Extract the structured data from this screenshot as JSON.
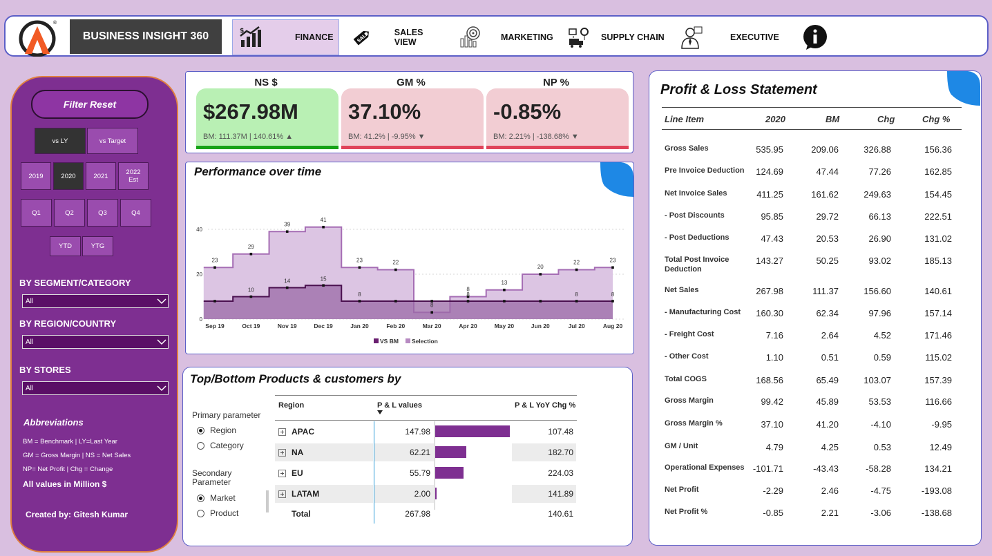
{
  "nav": {
    "brand": "BUSINESS INSIGHT 360",
    "items": [
      {
        "label": "FINANCE",
        "icon": "finance-chart-icon"
      },
      {
        "label": "SALES VIEW",
        "icon": "sale-tag-icon"
      },
      {
        "label": "MARKETING",
        "icon": "target-chart-icon"
      },
      {
        "label": "SUPPLY CHAIN",
        "icon": "supply-chain-icon"
      },
      {
        "label": "EXECUTIVE",
        "icon": "executive-icon"
      }
    ],
    "info_icon": "info-icon"
  },
  "sidebar": {
    "filter_reset": "Filter Reset",
    "compare": [
      "vs LY",
      "vs Target"
    ],
    "compare_selected": "vs LY",
    "years": [
      "2019",
      "2020",
      "2021",
      "2022 Est"
    ],
    "year_selected": "2020",
    "quarters": [
      "Q1",
      "Q2",
      "Q3",
      "Q4"
    ],
    "period": [
      "YTD",
      "YTG"
    ],
    "segment_label": "BY SEGMENT/CATEGORY",
    "segment_value": "All",
    "region_label": "BY REGION/COUNTRY",
    "region_value": "All",
    "stores_label": "BY STORES",
    "stores_value": "All",
    "abbr_title": "Abbreviations",
    "abbr_lines": [
      "BM = Benchmark | LY=Last Year",
      "GM = Gross Margin | NS = Net Sales",
      "NP= Net Profit | Chg = Change"
    ],
    "all_values": "All values in Million $",
    "created_by": "Created by: Gitesh Kumar"
  },
  "kpis": [
    {
      "title": "NS $",
      "value": "$267.98M",
      "sub": "BM: 111.37M | 140.61% ▲",
      "bg": "#b9f0b4",
      "bar": "#17a317"
    },
    {
      "title": "GM %",
      "value": "37.10%",
      "sub": "BM: 41.2% | -9.95% ▼",
      "bg": "#f2cdd3",
      "bar": "#e0435a"
    },
    {
      "title": "NP %",
      "value": "-0.85%",
      "sub": "BM: 2.21% | -138.68% ▼",
      "bg": "#f2cdd3",
      "bar": "#e0435a"
    }
  ],
  "performance": {
    "title": "Performance over time",
    "chart_data": {
      "type": "area",
      "categories": [
        "Sep 19",
        "Oct 19",
        "Nov 19",
        "Dec 19",
        "Jan 20",
        "Feb 20",
        "Mar 20",
        "Apr 20",
        "May 20",
        "Jun 20",
        "Jul 20",
        "Aug 20"
      ],
      "series": [
        {
          "name": "VS BM",
          "values": [
            8,
            10,
            14,
            15,
            8,
            8,
            8,
            8,
            8,
            8,
            8,
            8
          ],
          "labels": [
            "",
            "10",
            "14",
            "15",
            "8",
            "",
            "",
            "8",
            "",
            "",
            "8",
            "8"
          ],
          "color": "#6a1f70"
        },
        {
          "name": "Selection",
          "values": [
            23,
            29,
            39,
            41,
            23,
            22,
            3,
            10,
            13,
            20,
            22,
            23
          ],
          "labels": [
            "23",
            "29",
            "39",
            "41",
            "23",
            "22",
            "8",
            "8",
            "13",
            "20",
            "22",
            "23"
          ],
          "color": "#b78ac2"
        }
      ],
      "yticks": [
        "0",
        "20",
        "40"
      ],
      "ylim": [
        0,
        50
      ],
      "grid": true,
      "legend": "bottom-center",
      "extra_labels": [
        "3",
        "10"
      ]
    }
  },
  "topbottom": {
    "title": "Top/Bottom Products & customers by",
    "primary_label": "Primary parameter",
    "primary_options": [
      "Region",
      "Category"
    ],
    "primary_selected": "Region",
    "secondary_label": "Secondary Parameter",
    "secondary_options": [
      "Market",
      "Product"
    ],
    "secondary_selected": "Market",
    "columns": [
      "Region",
      "P & L values",
      "P & L YoY Chg %"
    ],
    "rows": [
      {
        "name": "APAC",
        "value": "147.98",
        "bar": 147.98,
        "chg": "107.48"
      },
      {
        "name": "NA",
        "value": "62.21",
        "bar": 62.21,
        "chg": "182.70"
      },
      {
        "name": "EU",
        "value": "55.79",
        "bar": 55.79,
        "chg": "224.03"
      },
      {
        "name": "LATAM",
        "value": "2.00",
        "bar": 2.0,
        "chg": "141.89"
      }
    ],
    "total": {
      "name": "Total",
      "value": "267.98",
      "chg": "140.61"
    }
  },
  "pl": {
    "title": "Profit & Loss Statement",
    "columns": [
      "Line Item",
      "2020",
      "BM",
      "Chg",
      "Chg %"
    ],
    "rows": [
      [
        "Gross Sales",
        "535.95",
        "209.06",
        "326.88",
        "156.36"
      ],
      [
        "Pre Invoice Deduction",
        "124.69",
        "47.44",
        "77.26",
        "162.85"
      ],
      [
        "Net Invoice Sales",
        "411.25",
        "161.62",
        "249.63",
        "154.45"
      ],
      [
        " - Post Discounts",
        "95.85",
        "29.72",
        "66.13",
        "222.51"
      ],
      [
        " - Post Deductions",
        "47.43",
        "20.53",
        "26.90",
        "131.02"
      ],
      [
        "Total Post Invoice Deduction",
        "143.27",
        "50.25",
        "93.02",
        "185.13"
      ],
      [
        "Net Sales",
        "267.98",
        "111.37",
        "156.60",
        "140.61"
      ],
      [
        " - Manufacturing Cost",
        "160.30",
        "62.34",
        "97.96",
        "157.14"
      ],
      [
        " - Freight Cost",
        "7.16",
        "2.64",
        "4.52",
        "171.46"
      ],
      [
        " - Other Cost",
        "1.10",
        "0.51",
        "0.59",
        "115.02"
      ],
      [
        "Total COGS",
        "168.56",
        "65.49",
        "103.07",
        "157.39"
      ],
      [
        "Gross Margin",
        "99.42",
        "45.89",
        "53.53",
        "116.66"
      ],
      [
        "Gross Margin %",
        "37.10",
        "41.20",
        "-4.10",
        "-9.95"
      ],
      [
        "GM / Unit",
        "4.79",
        "4.25",
        "0.53",
        "12.49"
      ],
      [
        "Operational Expenses",
        "-101.71",
        "-43.43",
        "-58.28",
        "134.21"
      ],
      [
        "Net Profit",
        "-2.29",
        "2.46",
        "-4.75",
        "-193.08"
      ],
      [
        "Net Profit %",
        "-0.85",
        "2.21",
        "-3.06",
        "-138.68"
      ]
    ]
  },
  "colors": {
    "accent": "#7e2f91",
    "panel_border": "#5b5fc7",
    "fold": "#1e88e5"
  }
}
